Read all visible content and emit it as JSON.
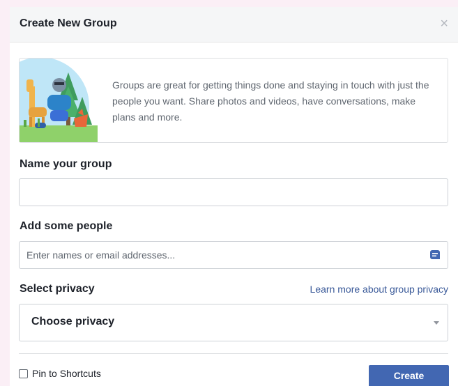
{
  "dialog": {
    "title": "Create New Group",
    "close_icon": "close-icon",
    "close_glyph": "×"
  },
  "intro": {
    "text": "Groups are great for getting things done and staying in touch with just the people you want. Share photos and videos, have conversations, make plans and more.",
    "illustration": "animals-illustration"
  },
  "name_group": {
    "label": "Name your group",
    "value": "",
    "placeholder": ""
  },
  "add_people": {
    "label": "Add some people",
    "value": "",
    "placeholder": "Enter names or email addresses...",
    "icon": "contacts-icon"
  },
  "privacy": {
    "label": "Select privacy",
    "link": "Learn more about group privacy",
    "selected": "Choose privacy",
    "caret_icon": "chevron-down-icon"
  },
  "footer": {
    "pin_label": "Pin to Shortcuts",
    "pin_checked": false,
    "create_label": "Create"
  },
  "colors": {
    "accent": "#4267b2",
    "link": "#385898",
    "header_bg": "#f5f6f7",
    "page_bg": "#fbeff6"
  }
}
